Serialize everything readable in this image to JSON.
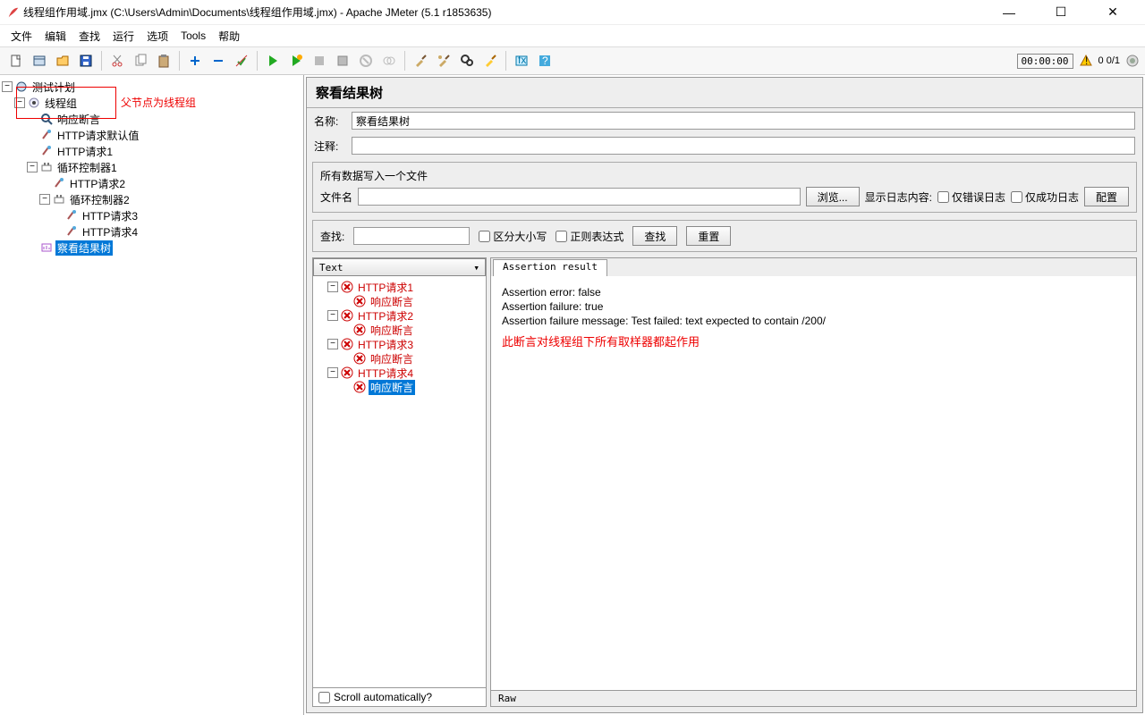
{
  "window": {
    "title": "线程组作用域.jmx (C:\\Users\\Admin\\Documents\\线程组作用域.jmx) - Apache JMeter (5.1 r1853635)"
  },
  "menu": [
    "文件",
    "编辑",
    "查找",
    "运行",
    "选项",
    "Tools",
    "帮助"
  ],
  "status": {
    "timer": "00:00:00",
    "counter": "0 0/1"
  },
  "tree": {
    "root": "测试计划",
    "thread_group": "线程组",
    "items": [
      "响应断言",
      "HTTP请求默认值",
      "HTTP请求1",
      "循环控制器1",
      "HTTP请求2",
      "循环控制器2",
      "HTTP请求3",
      "HTTP请求4",
      "察看结果树"
    ]
  },
  "annotation": {
    "parent_note": "父节点为线程组",
    "scope_note": "此断言对线程组下所有取样器都起作用"
  },
  "panel": {
    "title": "察看结果树",
    "name_label": "名称:",
    "name_value": "察看结果树",
    "comment_label": "注释:",
    "file_legend": "所有数据写入一个文件",
    "filename_label": "文件名",
    "browse": "浏览...",
    "log_label": "显示日志内容:",
    "only_errors": "仅错误日志",
    "only_success": "仅成功日志",
    "configure": "配置"
  },
  "search": {
    "label": "查找:",
    "case": "区分大小写",
    "regex": "正则表达式",
    "find_btn": "查找",
    "reset_btn": "重置"
  },
  "results": {
    "view_mode": "Text",
    "items": [
      {
        "name": "HTTP请求1",
        "children": [
          "响应断言"
        ]
      },
      {
        "name": "HTTP请求2",
        "children": [
          "响应断言"
        ]
      },
      {
        "name": "HTTP请求3",
        "children": [
          "响应断言"
        ]
      },
      {
        "name": "HTTP请求4",
        "children": [
          "响应断言"
        ]
      }
    ],
    "selected": "响应断言",
    "scroll_label": "Scroll automatically?",
    "tab": "Assertion result",
    "lines": [
      "Assertion error: false",
      "Assertion failure: true",
      "Assertion failure message: Test failed: text expected to contain /200/"
    ],
    "raw": "Raw"
  }
}
